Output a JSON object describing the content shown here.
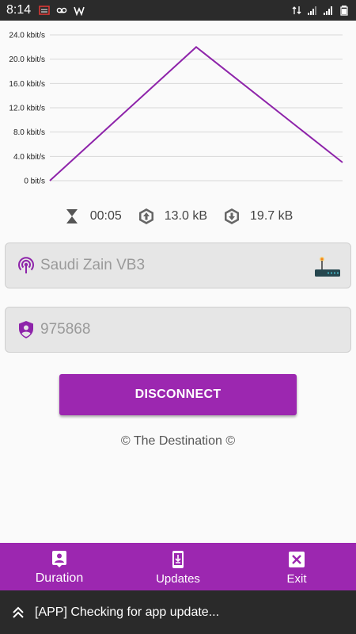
{
  "status_bar": {
    "time": "8:14",
    "left_icons": [
      "notification-icon",
      "voicemail-icon",
      "w-app-icon"
    ],
    "right_icons": [
      "data-arrows-icon",
      "signal-icon",
      "signal-icon",
      "battery-icon"
    ]
  },
  "chart_data": {
    "type": "line",
    "x": [
      0,
      1,
      2
    ],
    "series": [
      {
        "values": [
          0,
          22,
          3
        ],
        "color": "#8e24aa"
      }
    ],
    "y_ticks": [
      0,
      4,
      8,
      12,
      16,
      20,
      24
    ],
    "y_tick_labels": [
      "0 bit/s",
      "4.0 kbit/s",
      "8.0 kbit/s",
      "12.0 kbit/s",
      "16.0 kbit/s",
      "20.0 kbit/s",
      "24.0 kbit/s"
    ],
    "ylim": [
      0,
      24
    ],
    "grid": true,
    "title": "",
    "xlabel": "",
    "ylabel": ""
  },
  "stats": {
    "duration": "00:05",
    "upload": "13.0 kB",
    "download": "19.7 kB"
  },
  "server_field": {
    "value": "Saudi Zain VB3"
  },
  "password_field": {
    "value": "975868"
  },
  "connect_button": {
    "label": "DISCONNECT"
  },
  "credit": "© The Destination ©",
  "bottom_nav": {
    "items": [
      {
        "label": "Duration",
        "icon": "person-card-icon"
      },
      {
        "label": "Updates",
        "icon": "phone-download-icon"
      },
      {
        "label": "Exit",
        "icon": "close-box-icon"
      }
    ]
  },
  "log": {
    "message": "[APP] Checking for app update..."
  },
  "colors": {
    "accent": "#9c27b0",
    "chart_line": "#8e24aa"
  }
}
